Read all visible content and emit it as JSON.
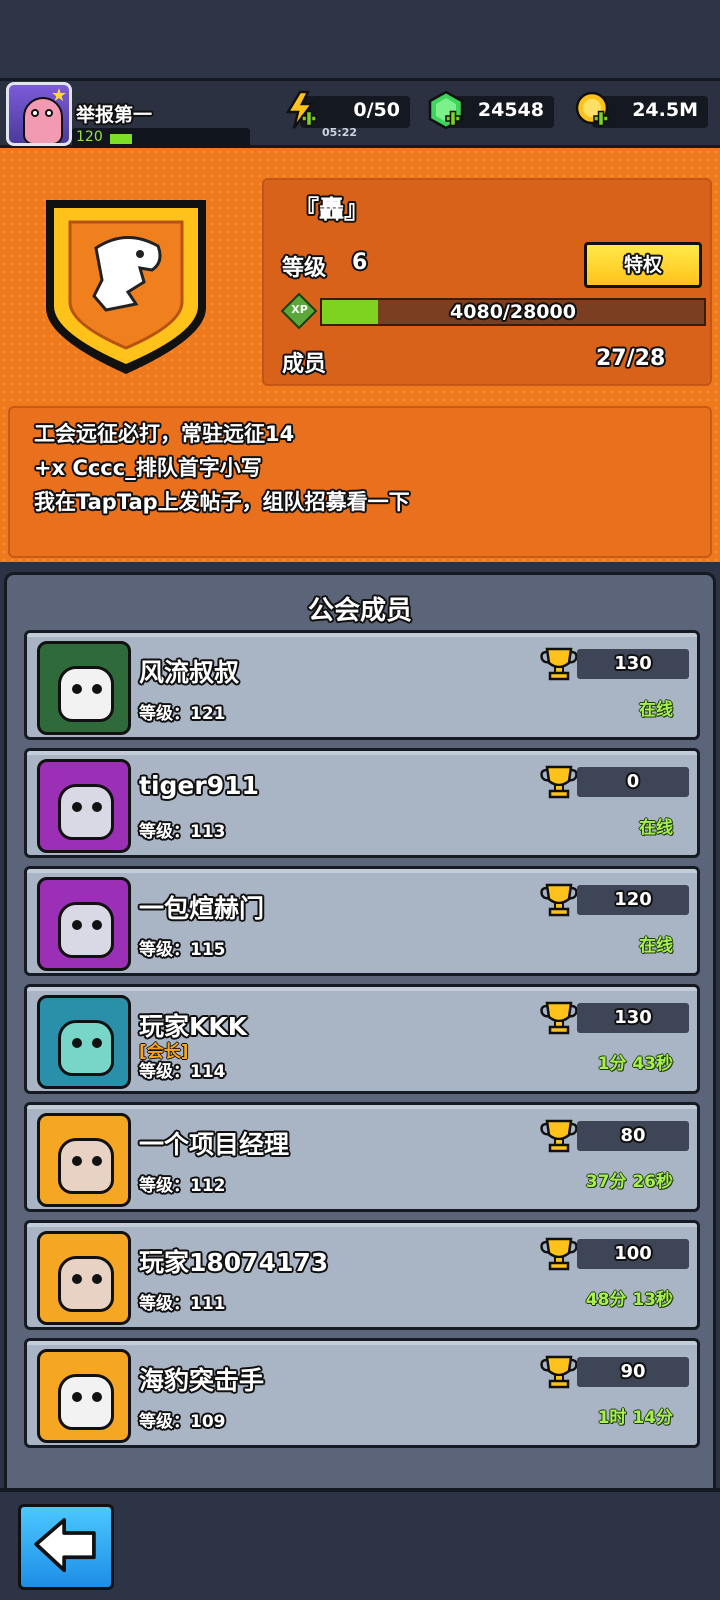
{
  "player": {
    "name": "举报第一",
    "level": "120",
    "level_progress": 0.12
  },
  "currencies": {
    "energy": "0/50",
    "energy_timer": "05:22",
    "gems": "24548",
    "coins": "24.5M"
  },
  "guild": {
    "name": "『轟』",
    "level_label": "等级",
    "level_value": "6",
    "privilege_button": "特权",
    "xp_text": "4080/28000",
    "xp_progress": 0.1457,
    "members_label": "成员",
    "members_count": "27/28",
    "notice": [
      "工会远征必打，常驻远征14",
      " +x  Cccc_排队首字小写",
      "我在TapTap上发帖子，组队招募看一下"
    ]
  },
  "members_title": "公会成员",
  "level_prefix": "等级：",
  "members": [
    {
      "name": "风流叔叔",
      "level": "121",
      "score": "130",
      "status": "在线",
      "role": "",
      "avatar_bg": "#2f6b3a",
      "pet_color": "#f2f2f2"
    },
    {
      "name": "tiger911",
      "level": "113",
      "score": "0",
      "status": "在线",
      "role": "",
      "avatar_bg": "#9b2fb6",
      "pet_color": "#d9d9e6"
    },
    {
      "name": "一包煊赫门",
      "level": "115",
      "score": "120",
      "status": "在线",
      "role": "",
      "avatar_bg": "#9b2fb6",
      "pet_color": "#d9d9e6"
    },
    {
      "name": "玩家KKK",
      "level": "114",
      "score": "130",
      "status": "1分 43秒",
      "role": "[会长]",
      "avatar_bg": "#2a8fa8",
      "pet_color": "#78d6c9"
    },
    {
      "name": "一个项目经理",
      "level": "112",
      "score": "80",
      "status": "37分 26秒",
      "role": "",
      "avatar_bg": "#f5a623",
      "pet_color": "#e8d2c4"
    },
    {
      "name": "玩家18074173",
      "level": "111",
      "score": "100",
      "status": "48分 13秒",
      "role": "",
      "avatar_bg": "#f5a623",
      "pet_color": "#e8d2c4"
    },
    {
      "name": "海豹突击手",
      "level": "109",
      "score": "90",
      "status": "1时 14分",
      "role": "",
      "avatar_bg": "#f5a623",
      "pet_color": "#f2f2f2"
    }
  ]
}
